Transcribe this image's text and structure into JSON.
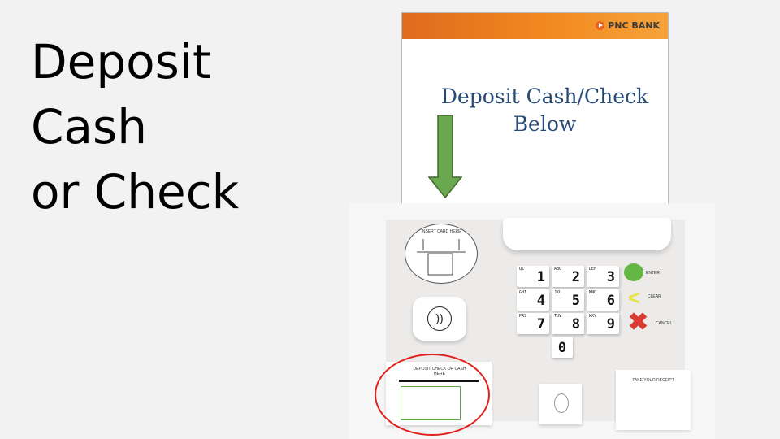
{
  "slide": {
    "title_lines": [
      "Deposit",
      "Cash",
      "or Check"
    ]
  },
  "atm_screen": {
    "brand": "PNC BANK",
    "message_line1": "Deposit Cash/Check",
    "message_line2": "Below",
    "header_color": "#f1891f",
    "message_color": "#284a77",
    "arrow_color": "#6aa84f"
  },
  "keypad": {
    "keys": [
      {
        "digit": "1",
        "letters": "QZ"
      },
      {
        "digit": "2",
        "letters": "ABC"
      },
      {
        "digit": "3",
        "letters": "DEF"
      },
      {
        "digit": "4",
        "letters": "GHI"
      },
      {
        "digit": "5",
        "letters": "JKL"
      },
      {
        "digit": "6",
        "letters": "MNO"
      },
      {
        "digit": "7",
        "letters": "PRS"
      },
      {
        "digit": "8",
        "letters": "TUV"
      },
      {
        "digit": "9",
        "letters": "WXY"
      },
      {
        "digit": "0",
        "letters": ""
      }
    ],
    "enter_label": "ENTER",
    "clear_label": "CLEAR",
    "cancel_label": "CANCEL"
  },
  "card_reader": {
    "label": "INSERT CARD HERE"
  },
  "tap": {
    "icon": "contactless-icon",
    "glyph": "))"
  },
  "check_slot": {
    "label": "DEPOSIT CHECK OR CASH HERE"
  },
  "receipt": {
    "label": "TAKE YOUR RECEIPT"
  },
  "highlight_color": "#e0201b"
}
